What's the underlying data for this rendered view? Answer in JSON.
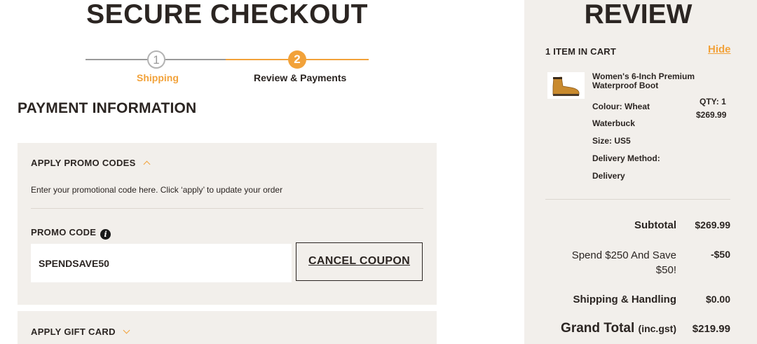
{
  "checkout": {
    "title": "SECURE CHECKOUT",
    "steps": [
      {
        "number": "1",
        "label": "Shipping"
      },
      {
        "number": "2",
        "label": "Review & Payments"
      }
    ],
    "payment_heading": "PAYMENT INFORMATION",
    "promo": {
      "header": "APPLY PROMO CODES",
      "description": "Enter your promotional code here. Click ‘apply’ to update your order",
      "label": "PROMO CODE",
      "info_icon": "i",
      "value": "SPENDSAVE50",
      "cancel_label": "CANCEL COUPON"
    },
    "gift_card": {
      "header": "APPLY GIFT CARD"
    }
  },
  "review": {
    "title": "REVIEW",
    "items_count": "1 ITEM IN CART",
    "hide_label": "Hide",
    "item": {
      "name": "Women's 6-Inch Premium Waterproof Boot",
      "colour": "Colour:  Wheat",
      "colour_cont": "Waterbuck",
      "size": "Size:  US5",
      "delivery_label": "Delivery Method:",
      "delivery_value": "Delivery",
      "qty": "QTY: 1",
      "price": "$269.99"
    },
    "summary": {
      "subtotal_label": "Subtotal",
      "subtotal_value": "$269.99",
      "discount_label": "Spend $250 And Save $50!",
      "discount_value": "-$50",
      "shipping_label": "Shipping & Handling",
      "shipping_value": "$0.00",
      "grand_label": "Grand Total",
      "grand_suffix": "(inc.gst)",
      "grand_value": "$219.99"
    }
  },
  "colors": {
    "accent": "#f2a23a",
    "panel": "#f2efeb",
    "text": "#2b2522"
  },
  "icons": [
    "info-icon",
    "chevron-up-icon",
    "chevron-down-icon",
    "boot-thumbnail"
  ]
}
